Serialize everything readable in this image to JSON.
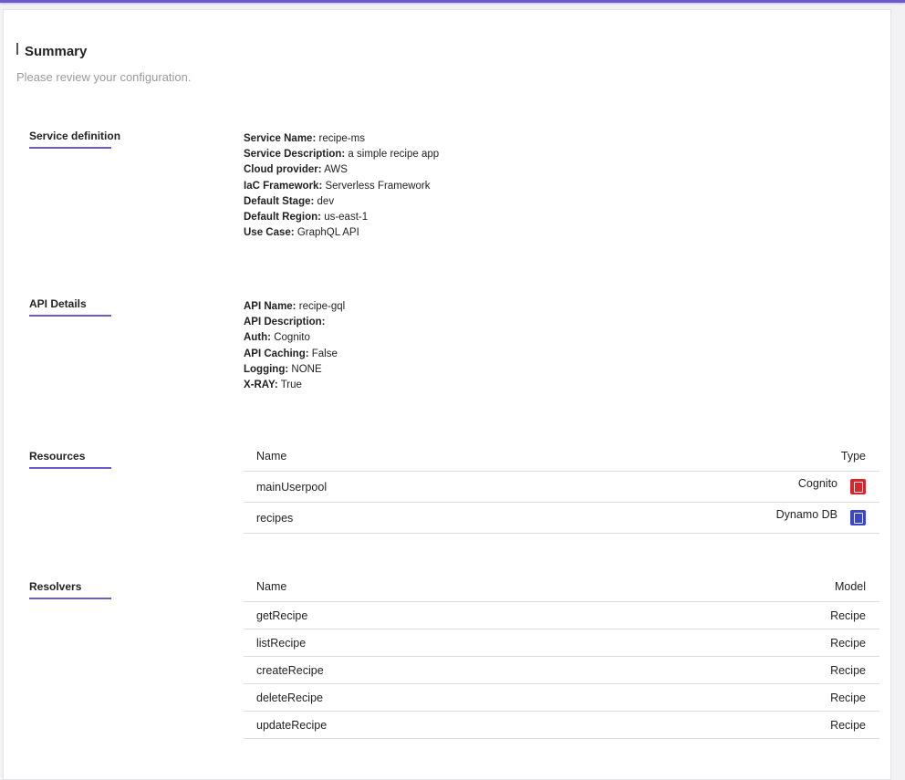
{
  "summary": {
    "title": "Summary",
    "subtitle": "Please review your configuration."
  },
  "service_definition": {
    "label": "Service definition",
    "fields": [
      {
        "key": "Service Name:",
        "value": "recipe-ms"
      },
      {
        "key": "Service Description:",
        "value": "a simple recipe app"
      },
      {
        "key": "Cloud provider:",
        "value": "AWS"
      },
      {
        "key": "IaC Framework:",
        "value": "Serverless Framework"
      },
      {
        "key": "Default Stage:",
        "value": "dev"
      },
      {
        "key": "Default Region:",
        "value": "us-east-1"
      },
      {
        "key": "Use Case:",
        "value": "GraphQL API"
      }
    ]
  },
  "api_details": {
    "label": "API Details",
    "fields": [
      {
        "key": "API Name:",
        "value": "recipe-gql"
      },
      {
        "key": "API Description:",
        "value": ""
      },
      {
        "key": "Auth:",
        "value": "Cognito"
      },
      {
        "key": "API Caching:",
        "value": "False"
      },
      {
        "key": "Logging:",
        "value": "NONE"
      },
      {
        "key": "X-RAY:",
        "value": "True"
      }
    ]
  },
  "resources": {
    "label": "Resources",
    "col_name": "Name",
    "col_type": "Type",
    "rows": [
      {
        "name": "mainUserpool",
        "type": "Cognito",
        "icon": "cognito-icon",
        "color": "#d6262d"
      },
      {
        "name": "recipes",
        "type": "Dynamo DB",
        "icon": "dynamodb-icon",
        "color": "#3b45c9"
      }
    ]
  },
  "resolvers": {
    "label": "Resolvers",
    "col_name": "Name",
    "col_model": "Model",
    "rows": [
      {
        "name": "getRecipe",
        "model": "Recipe"
      },
      {
        "name": "listRecipe",
        "model": "Recipe"
      },
      {
        "name": "createRecipe",
        "model": "Recipe"
      },
      {
        "name": "deleteRecipe",
        "model": "Recipe"
      },
      {
        "name": "updateRecipe",
        "model": "Recipe"
      }
    ]
  },
  "colors": {
    "accent": "#6a5acd"
  }
}
